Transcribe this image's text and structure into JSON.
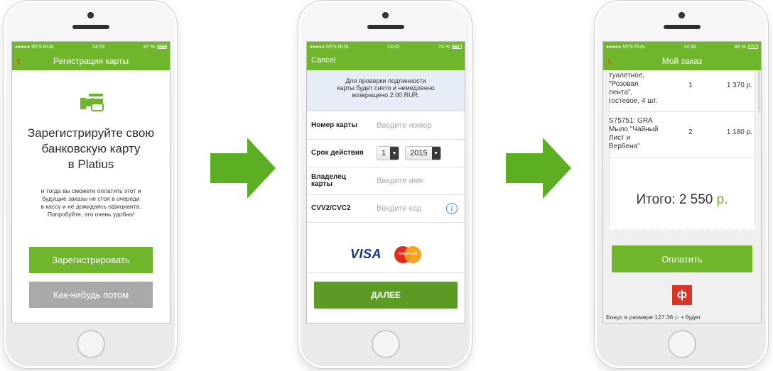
{
  "colors": {
    "accent": "#6fb62c",
    "accent_dark": "#5c9a26",
    "back_arrow": "#e84b26",
    "gray_button": "#a9a9a9"
  },
  "phone1": {
    "status": {
      "carrier": "●●●●● MTS RUS",
      "time": "14:53",
      "battery": "87 %",
      "battery_level": 0.87
    },
    "nav": {
      "title": "Регистрация карты",
      "back_icon": "chevron-left-icon"
    },
    "icon": "hand-card-icon",
    "title_lines": [
      "Зарегистрируйте свою",
      "банковскую карту",
      "в Platius"
    ],
    "description_lines": [
      "и тогда вы сможете оплатить этот и",
      "будущие заказы не стоя в очереди",
      "в кассу и не дожидаясь официанта.",
      "Попробуйте, это очень удобно!"
    ],
    "register_button": "Зарегистрировать",
    "later_button": "Как-нибудь потом"
  },
  "phone2": {
    "status": {
      "carrier": "●●●●● MTS RUS",
      "time": "13:42",
      "battery": "73 %",
      "battery_level": 0.73
    },
    "nav": {
      "cancel": "Cancel"
    },
    "info_lines": [
      "Для проверки подлинности",
      "карты будет снято и немедленно",
      "возвращено 2.00 RUR."
    ],
    "fields": {
      "card_number": {
        "label": "Номер карты",
        "placeholder": "Введите номер"
      },
      "expiry": {
        "label": "Срок действия",
        "month": "1",
        "year": "2015"
      },
      "owner": {
        "label_lines": [
          "Владелец",
          "карты"
        ],
        "placeholder": "Введите имя"
      },
      "cvv": {
        "label": "CVV2/CVC2",
        "placeholder": "Введите код",
        "info_icon": "i"
      }
    },
    "card_logos": {
      "visa": "VISA",
      "mastercard": "MasterCard"
    },
    "next_button": "ДАЛЕЕ"
  },
  "phone3": {
    "status": {
      "carrier": "●●●●● MTS RUS",
      "time": "14:49",
      "battery": "86 %",
      "battery_level": 0.86
    },
    "nav": {
      "title": "Мой заказ",
      "back_icon": "chevron-left-icon"
    },
    "items": [
      {
        "name_lines": [
          "туалетное,",
          "\"Розовая",
          "лента\",",
          "гостевое, 4 шт."
        ],
        "qty": "1",
        "price": "1 370 р."
      },
      {
        "name_lines": [
          "S75751: GRA",
          "Мыло \"Чайный",
          "Лист и",
          "Вербена\""
        ],
        "qty": "2",
        "price": "1 180 р."
      }
    ],
    "total_label": "Итого: 2 550",
    "total_currency": "р.",
    "pay_button": "Оплатить",
    "logo_glyph": "ф",
    "bonus_prefix": "Бонус в размере 127.36",
    "bonus_currency": "р.",
    "bonus_suffix": "• будет"
  }
}
